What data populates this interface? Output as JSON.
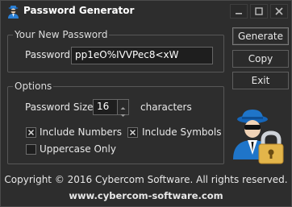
{
  "window": {
    "title": "Password Generator"
  },
  "password_group": {
    "title": "Your New Password",
    "password_label": "Password:",
    "password_value": "pp1eO%IVVPec8<xW"
  },
  "options_group": {
    "title": "Options",
    "size_label": "Password Size:",
    "size_value": "16",
    "size_unit": "characters",
    "include_numbers": {
      "label": "Include Numbers",
      "checked": true
    },
    "include_symbols": {
      "label": "Include Symbols",
      "checked": true
    },
    "uppercase_only": {
      "label": "Uppercase Only",
      "checked": false
    }
  },
  "buttons": {
    "generate": "Generate",
    "copy": "Copy",
    "exit": "Exit"
  },
  "footer": {
    "copyright": "Copyright © 2016 Cybercom Software. All rights reserved.",
    "website": "www.cybercom-software.com"
  },
  "icons": {
    "app": "spy-agent-icon",
    "illustration": "agent-with-padlock-icon"
  },
  "colors": {
    "background": "#2d2d2d",
    "agent_blue": "#1f75c9",
    "padlock_gold": "#e3b54a"
  }
}
